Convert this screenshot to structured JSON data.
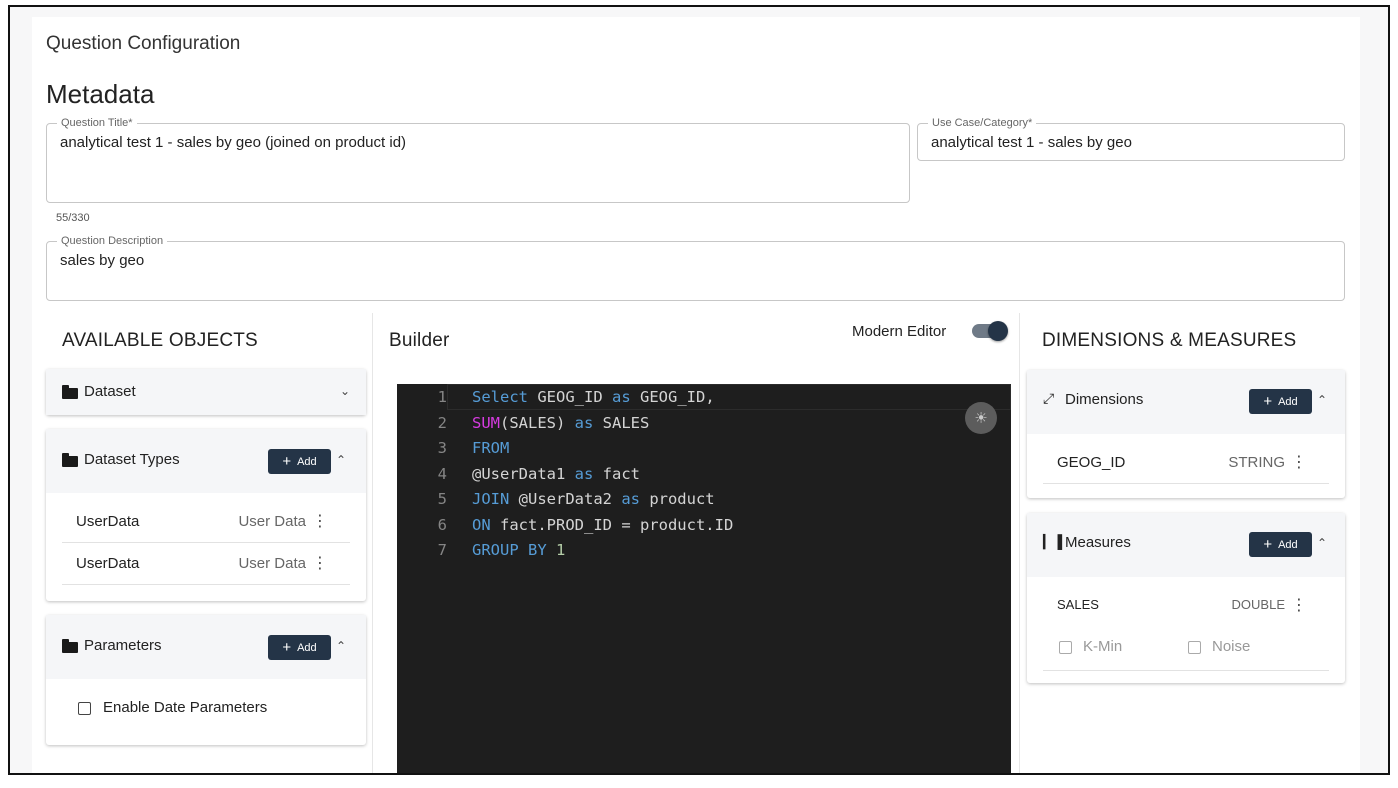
{
  "card": {
    "title": "Question Configuration"
  },
  "metadata": {
    "section_title": "Metadata",
    "question_title": {
      "label": "Question Title*",
      "value": "analytical test 1 - sales by geo (joined on product id)",
      "counter": "55/330"
    },
    "use_case": {
      "label": "Use Case/Category*",
      "value": "analytical test 1 - sales by geo"
    },
    "description": {
      "label": "Question Description",
      "value": "sales by geo"
    }
  },
  "available_objects": {
    "heading": "AVAILABLE OBJECTS",
    "dataset": {
      "label": "Dataset"
    },
    "dataset_types": {
      "label": "Dataset Types",
      "add_label": "Add",
      "rows": [
        {
          "name": "UserData",
          "type": "User Data"
        },
        {
          "name": "UserData",
          "type": "User Data"
        }
      ]
    },
    "parameters": {
      "label": "Parameters",
      "add_label": "Add",
      "enable_date_label": "Enable Date Parameters"
    }
  },
  "builder": {
    "heading": "Builder",
    "modern_editor_label": "Modern Editor",
    "modern_editor_on": true,
    "code_lines": [
      {
        "n": "1",
        "parts": [
          [
            "kw",
            "Select"
          ],
          [
            "",
            " GEOG_ID "
          ],
          [
            "kw",
            "as"
          ],
          [
            "",
            " GEOG_ID,"
          ]
        ]
      },
      {
        "n": "2",
        "parts": [
          [
            "fn",
            "SUM"
          ],
          [
            "",
            "(SALES) "
          ],
          [
            "kw",
            "as"
          ],
          [
            "",
            " SALES"
          ]
        ]
      },
      {
        "n": "3",
        "parts": [
          [
            "kw",
            "FROM"
          ]
        ]
      },
      {
        "n": "4",
        "parts": [
          [
            "",
            "@UserData1 "
          ],
          [
            "kw",
            "as"
          ],
          [
            "",
            " fact"
          ]
        ]
      },
      {
        "n": "5",
        "parts": [
          [
            "kw",
            "JOIN"
          ],
          [
            "",
            " @UserData2 "
          ],
          [
            "kw",
            "as"
          ],
          [
            "",
            " product"
          ]
        ]
      },
      {
        "n": "6",
        "parts": [
          [
            "kw",
            "ON"
          ],
          [
            "",
            " fact.PROD_ID = product.ID"
          ]
        ]
      },
      {
        "n": "7",
        "parts": [
          [
            "kw",
            "GROUP BY"
          ],
          [
            "",
            " "
          ],
          [
            "num",
            "1"
          ]
        ]
      }
    ]
  },
  "dims_measures": {
    "heading": "DIMENSIONS & MEASURES",
    "dimensions": {
      "label": "Dimensions",
      "add_label": "Add",
      "rows": [
        {
          "name": "GEOG_ID",
          "type": "STRING"
        }
      ]
    },
    "measures": {
      "label": "Measures",
      "add_label": "Add",
      "rows": [
        {
          "name": "SALES",
          "type": "DOUBLE"
        }
      ],
      "kmin_label": "K-Min",
      "noise_label": "Noise"
    }
  },
  "icons": {
    "folder": "folder-icon",
    "chevron_down": "chevron-down-icon",
    "chevron_up": "chevron-up-icon",
    "kebab": "kebab-menu-icon",
    "dimensions": "expand-icon",
    "measures": "bar-chart-icon",
    "theme": "sun-icon"
  },
  "colors": {
    "accent": "#243447",
    "editor_bg": "#1e1e1e",
    "keyword": "#569cd6",
    "function": "#d63be0"
  }
}
